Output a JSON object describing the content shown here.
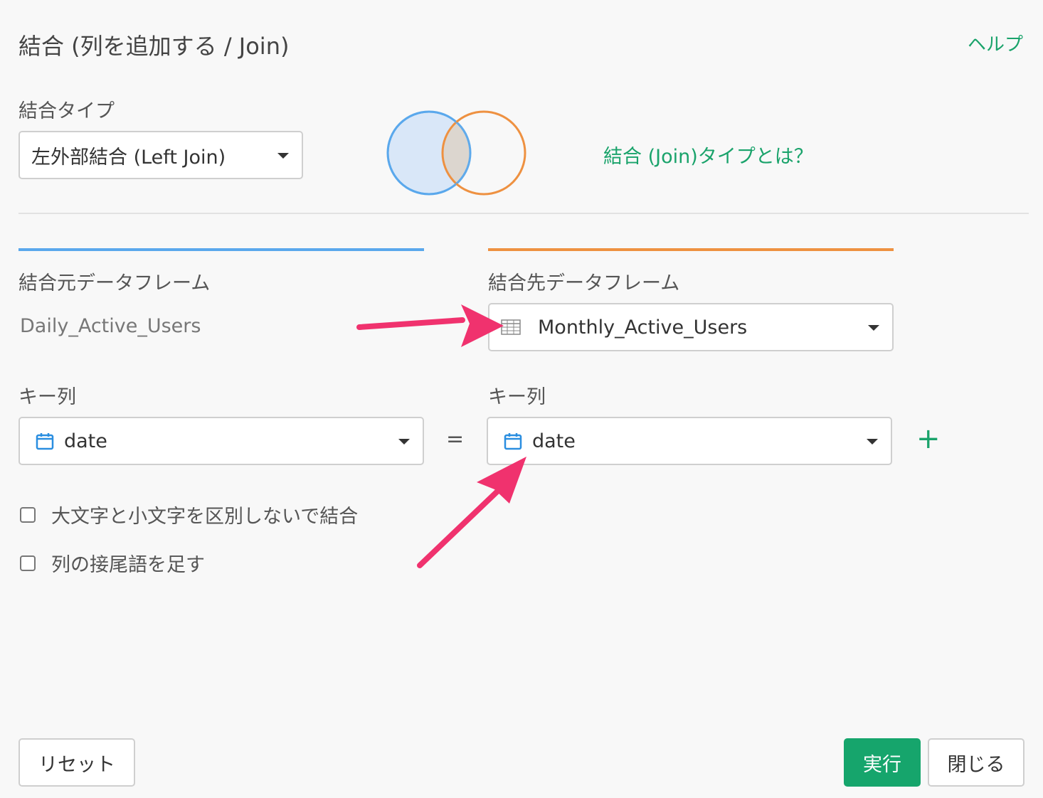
{
  "header": {
    "title": "結合 (列を追加する / Join)",
    "help_label": "ヘルプ"
  },
  "join_type": {
    "label": "結合タイプ",
    "selected": "左外部結合 (Left Join)",
    "what_is_link": "結合 (Join)タイプとは？"
  },
  "colors": {
    "source_accent": "#5aa8ec",
    "target_accent": "#ee9141",
    "primary": "#16a56c"
  },
  "source": {
    "label": "結合元データフレーム",
    "dataframe": "Daily_Active_Users",
    "key_label": "キー列",
    "key_value": "date",
    "key_icon": "calendar-icon"
  },
  "target": {
    "label": "結合先データフレーム",
    "dataframe": "Monthly_Active_Users",
    "dataframe_icon": "table-icon",
    "key_label": "キー列",
    "key_value": "date",
    "key_icon": "calendar-icon"
  },
  "equals_sign": "=",
  "add_key_symbol": "+",
  "options": {
    "case_insensitive": "大文字と小文字を区別しないで結合",
    "add_suffix": "列の接尾語を足す"
  },
  "footer": {
    "reset_label": "リセット",
    "run_label": "実行",
    "close_label": "閉じる"
  }
}
